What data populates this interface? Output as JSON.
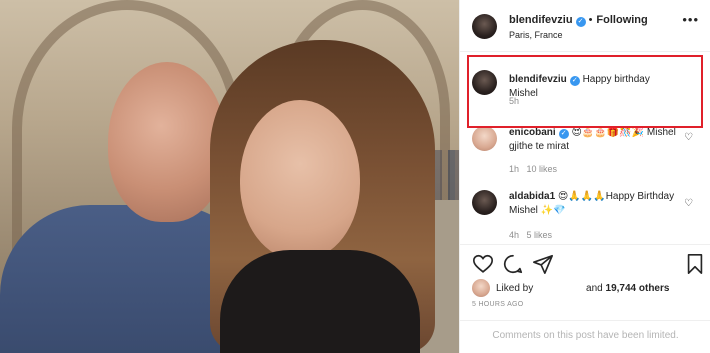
{
  "post": {
    "header": {
      "username": "blendifevziu",
      "follow_label": "Following",
      "location": "Paris, France",
      "more": "•••"
    },
    "comments": [
      {
        "username": "blendifevziu",
        "text": "Happy birthday Mishel",
        "time": "5h",
        "likes": "",
        "reply": ""
      },
      {
        "username": "enicobani",
        "text": "😍🎂🎂🎁🎊🎉 Mishel gjithe te mirat",
        "time": "1h",
        "likes": "10 likes",
        "reply": ""
      },
      {
        "username": "aldabida1",
        "text": "😍🙏🙏🙏Happy Birthday Mishel ✨💎",
        "time": "4h",
        "likes": "5 likes",
        "reply": ""
      }
    ],
    "likes_text_prefix": "Liked by",
    "likes_text_and": "and",
    "likes_count": "19,744 others",
    "time_ago": "5 HOURS AGO",
    "comments_limited": "Comments on this post have been limited."
  },
  "colors": {
    "highlight_border": "#e0202a",
    "verified_badge": "#3897f0",
    "muted_text": "#8e8e8e"
  },
  "icons": [
    "heart-icon",
    "comment-icon",
    "share-icon",
    "bookmark-icon",
    "verified-icon",
    "more-icon"
  ]
}
